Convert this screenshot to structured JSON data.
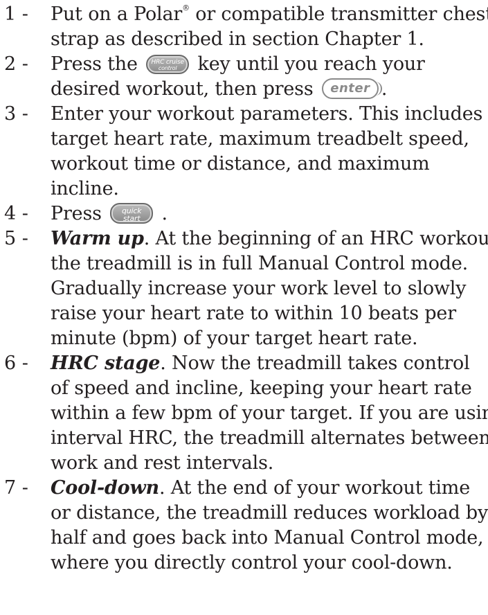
{
  "steps": [
    {
      "number": "1 -",
      "lines": [
        {
          "text_a": "Put on a Polar",
          "sup": "®",
          "text_b": " or compatible transmitter chest"
        },
        {
          "text": "strap as described in section Chapter 1."
        }
      ]
    },
    {
      "number": "2 -",
      "lines": [
        {
          "text_a": "Press the",
          "text_b": "key until you reach your"
        },
        {
          "text_a": "desired workout, then press",
          "text_b": "."
        }
      ]
    },
    {
      "number": "3 -",
      "lines": [
        {
          "text": "Enter your workout parameters. This includes"
        },
        {
          "text": "target heart rate, maximum treadbelt speed,"
        },
        {
          "text": "workout time or distance, and maximum"
        },
        {
          "text": "incline."
        }
      ]
    },
    {
      "number": "4 -",
      "lines": [
        {
          "text_a": "Press",
          "text_b": "."
        }
      ]
    },
    {
      "number": "5 -",
      "lead": "Warm up",
      "lines": [
        {
          "text_after_lead": ". At the beginning of an HRC workout,"
        },
        {
          "text": "the treadmill is in full Manual Control mode."
        },
        {
          "text": "Gradually increase your work level to slowly"
        },
        {
          "text": "raise your heart rate to within 10 beats per"
        },
        {
          "text": "minute (bpm) of your target heart rate."
        }
      ]
    },
    {
      "number": "6 -",
      "lead": "HRC stage",
      "lines": [
        {
          "text_after_lead": ". Now the treadmill takes control"
        },
        {
          "text": "of speed and incline, keeping your heart rate"
        },
        {
          "text": "within a few bpm of your target. If you are using"
        },
        {
          "text": "interval HRC, the treadmill alternates between"
        },
        {
          "text": "work and rest intervals."
        }
      ]
    },
    {
      "number": "7 -",
      "lead": "Cool-down",
      "lines": [
        {
          "text_after_lead": ". At the end of your workout time"
        },
        {
          "text": "or distance, the treadmill reduces workload by"
        },
        {
          "text": "half and goes back into Manual Control mode,"
        },
        {
          "text": "where you directly control your cool-down."
        }
      ]
    }
  ],
  "keys": {
    "hrc_cruise_control": {
      "line1": "HRC cruise",
      "line2": "control",
      "icon": "hrc-cruise-control-key-icon"
    },
    "enter": {
      "label": "enter",
      "icon": "enter-key-icon"
    },
    "quick_start": {
      "line1": "quick",
      "line2": "start",
      "icon": "quick-start-key-icon"
    }
  },
  "colors": {
    "text": "#231f20",
    "key_dark": "#8a8a8a"
  }
}
